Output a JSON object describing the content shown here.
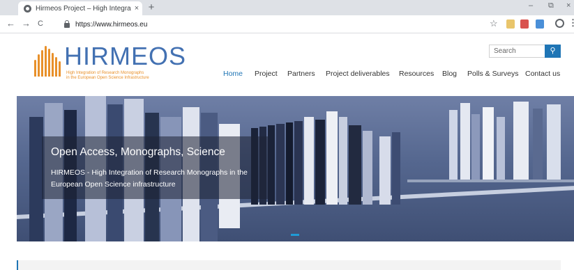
{
  "browser": {
    "tab_title": "Hirmeos Project – High Integratio",
    "tab_close": "×",
    "new_tab": "+",
    "url": "https://www.hirmeos.eu",
    "back": "←",
    "forward": "→",
    "reload": "C",
    "bookmark_icon": "star-icon",
    "window_controls": [
      "–",
      "⧉",
      "×"
    ]
  },
  "site": {
    "logo": {
      "wordmark": "HIRMEOS",
      "tagline_line1": "High Integration of Research Monographs",
      "tagline_line2": "in the European Open Science Infrastructure",
      "bar_color": "#e8902a",
      "text_color": "#4371b2"
    },
    "search": {
      "placeholder": "Search",
      "button_icon": "search-icon",
      "button_glyph": "⚲"
    },
    "nav": {
      "items": [
        {
          "label": "Home",
          "active": true
        },
        {
          "label": "Project"
        },
        {
          "label": "Partners"
        },
        {
          "label": "Project deliverables"
        },
        {
          "label": "Resources"
        },
        {
          "label": "Blog"
        },
        {
          "label": "Polls & Surveys"
        },
        {
          "label": "Contact us"
        }
      ],
      "active_color": "#1f75b5"
    },
    "hero": {
      "title": "Open Access, Monographs, Science",
      "description": "HIRMEOS - High Integration of Research Monographs in the European Open Science infrastructure",
      "dot_color": "#1f9bd6"
    }
  }
}
